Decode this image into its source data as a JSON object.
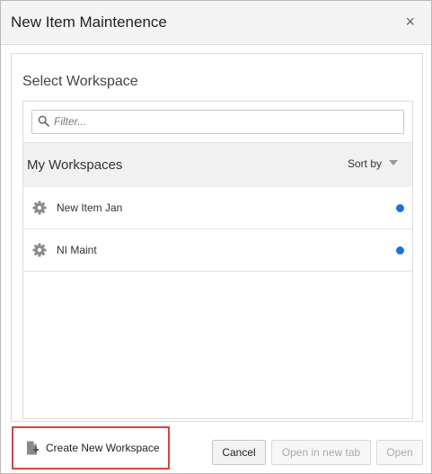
{
  "dialog": {
    "title": "New Item Maintenence",
    "close_glyph": "×"
  },
  "main": {
    "section_title": "Select Workspace",
    "filter": {
      "placeholder": "Filter...",
      "value": ""
    },
    "workspaces_header": "My Workspaces",
    "sort_label": "Sort by",
    "workspaces": [
      {
        "name": "New Item Jan",
        "icon": "gear-icon",
        "status_color": "#1a73d9"
      },
      {
        "name": "NI Maint",
        "icon": "gear-icon",
        "status_color": "#1a73d9"
      }
    ]
  },
  "footer": {
    "create_label": "Create New Workspace",
    "cancel_label": "Cancel",
    "open_new_tab_label": "Open in new tab",
    "open_label": "Open"
  },
  "colors": {
    "accent_blue": "#1a73d9",
    "highlight_red": "#d64541"
  }
}
